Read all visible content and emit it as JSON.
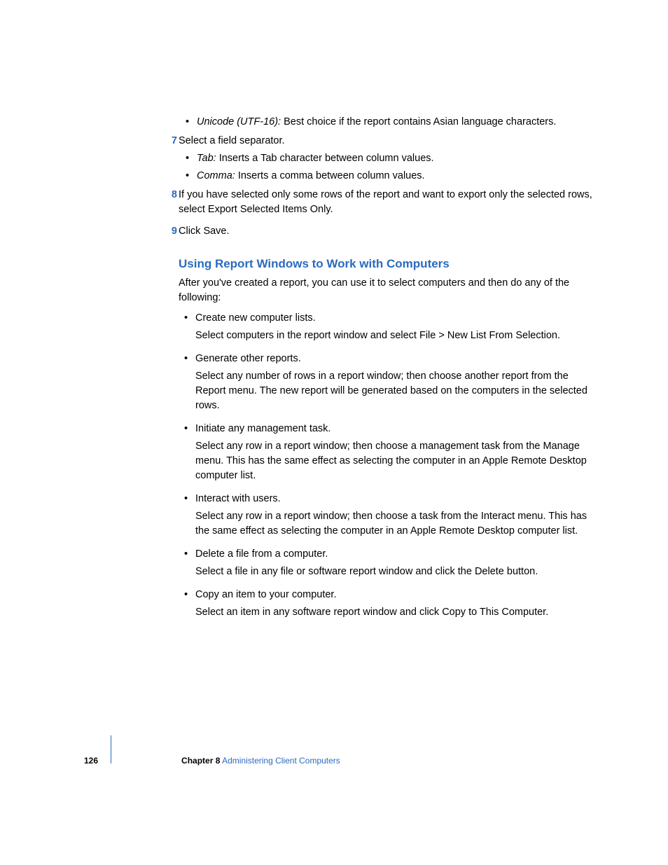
{
  "top": {
    "unicode_term": "Unicode (UTF-16):",
    "unicode_desc": "  Best choice if the report contains Asian language characters."
  },
  "step7": {
    "num": "7",
    "text": "Select a field separator.",
    "tab_term": "Tab:",
    "tab_desc": "  Inserts a Tab character between column values.",
    "comma_term": "Comma:",
    "comma_desc": "  Inserts a comma between column values."
  },
  "step8": {
    "num": "8",
    "text": "If you have selected only some rows of the report and want to export only the selected rows, select Export Selected Items Only."
  },
  "step9": {
    "num": "9",
    "text": "Click Save."
  },
  "heading": "Using Report Windows to Work with Computers",
  "intro": "After you've created a report, you can use it to select computers and then do any of the following:",
  "items": [
    {
      "title": "Create new computer lists.",
      "desc": "Select computers in the report window and select File > New List From Selection."
    },
    {
      "title": "Generate other reports.",
      "desc": "Select any number of rows in a report window; then choose another report from the Report menu. The new report will be generated based on the computers in the selected rows."
    },
    {
      "title": "Initiate any management task.",
      "desc": "Select any row in a report window; then choose a management task from the Manage menu. This has the same effect as selecting the computer in an Apple Remote Desktop computer list."
    },
    {
      "title": "Interact with users.",
      "desc": "Select any row in a report window; then choose a task from the Interact menu. This has the same effect as selecting the computer in an Apple Remote Desktop computer list."
    },
    {
      "title": "Delete a file from a computer.",
      "desc": "Select a file in any file or software report window and click the Delete button."
    },
    {
      "title": "Copy an item to your computer.",
      "desc": "Select an item in any software report window and click Copy to This Computer."
    }
  ],
  "footer": {
    "page": "126",
    "chapter_label": "Chapter 8",
    "chapter_title": "    Administering Client Computers"
  }
}
